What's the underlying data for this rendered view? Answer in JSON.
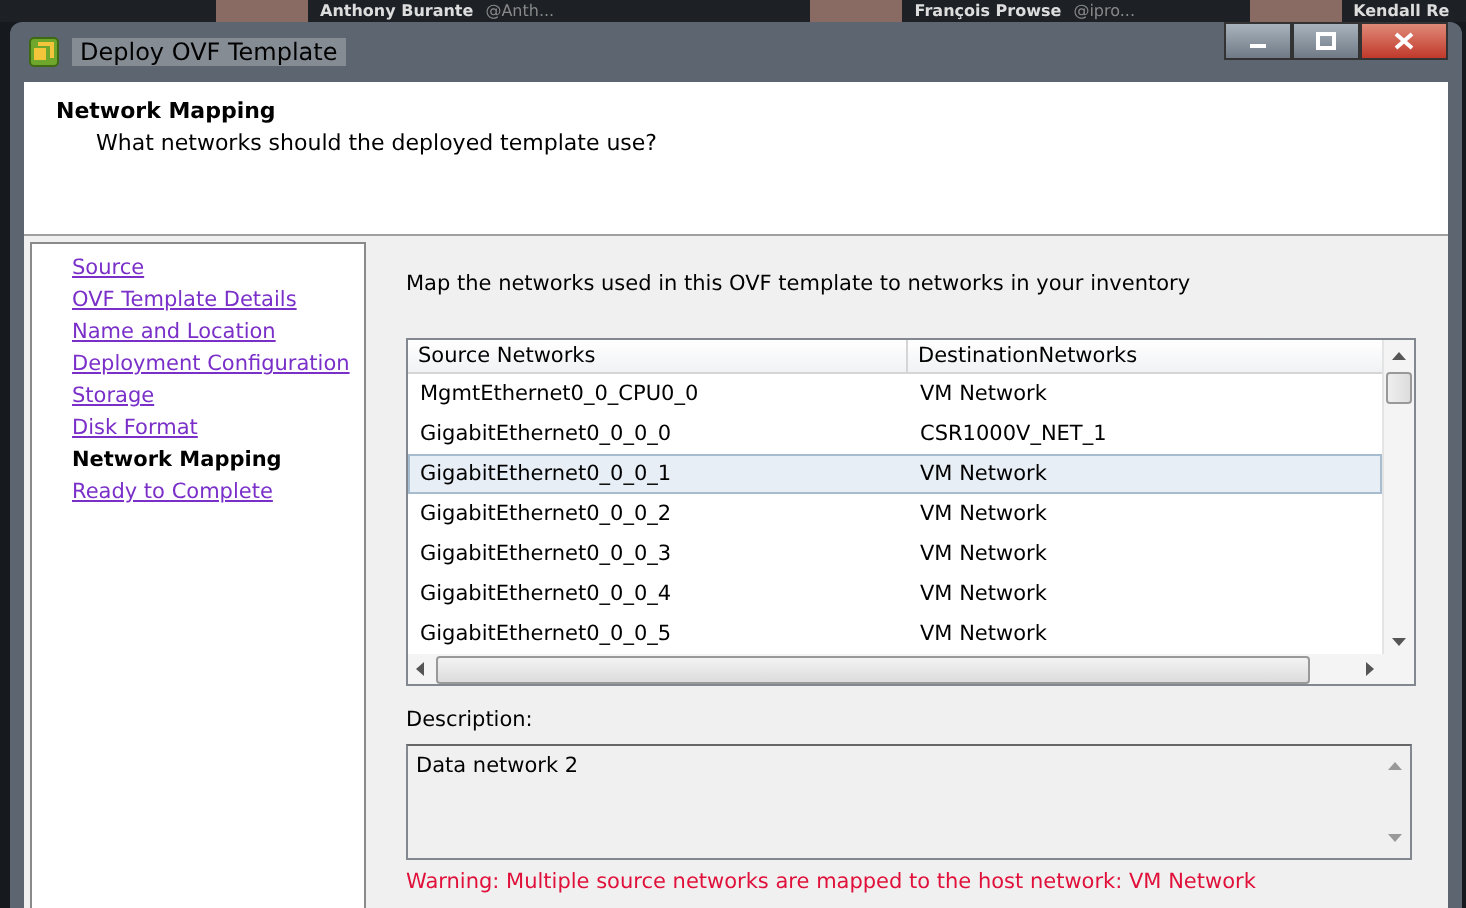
{
  "background_feed": [
    {
      "name": "Anthony Burante",
      "handle": "@Anth..."
    },
    {
      "name": "François Prowse",
      "handle": "@ipro..."
    },
    {
      "name": "Kendall Re"
    }
  ],
  "window": {
    "title": "Deploy OVF Template"
  },
  "header": {
    "title": "Network Mapping",
    "subtitle": "What networks should the deployed template use?"
  },
  "steps": [
    {
      "label": "Source",
      "selected": false
    },
    {
      "label": "OVF Template Details",
      "selected": false
    },
    {
      "label": "Name and Location",
      "selected": false
    },
    {
      "label": "Deployment Configuration",
      "selected": false
    },
    {
      "label": "Storage",
      "selected": false
    },
    {
      "label": "Disk Format",
      "selected": false
    },
    {
      "label": "Network Mapping",
      "selected": true
    },
    {
      "label": "Ready to Complete",
      "selected": false
    }
  ],
  "instruction": "Map the networks used in this OVF template to networks in your inventory",
  "table": {
    "columns": [
      "Source Networks",
      "DestinationNetworks"
    ],
    "rows": [
      {
        "source": "MgmtEthernet0_0_CPU0_0",
        "destination": "VM Network",
        "selected": false
      },
      {
        "source": "GigabitEthernet0_0_0_0",
        "destination": "CSR1000V_NET_1",
        "selected": false
      },
      {
        "source": "GigabitEthernet0_0_0_1",
        "destination": "VM Network",
        "selected": true
      },
      {
        "source": "GigabitEthernet0_0_0_2",
        "destination": "VM Network",
        "selected": false
      },
      {
        "source": "GigabitEthernet0_0_0_3",
        "destination": "VM Network",
        "selected": false
      },
      {
        "source": "GigabitEthernet0_0_0_4",
        "destination": "VM Network",
        "selected": false
      },
      {
        "source": "GigabitEthernet0_0_0_5",
        "destination": "VM Network",
        "selected": false
      }
    ]
  },
  "description": {
    "label": "Description:",
    "value": "Data network 2"
  },
  "warning": "Warning: Multiple source networks are mapped to the host network: VM Network"
}
